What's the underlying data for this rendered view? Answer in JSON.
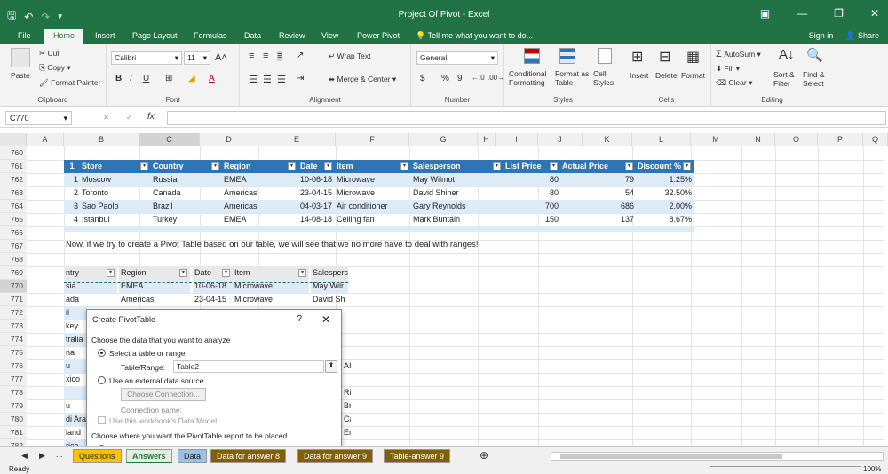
{
  "window": {
    "title": "Project Of Pivot - Excel"
  },
  "tabs": [
    "File",
    "Home",
    "Insert",
    "Page Layout",
    "Formulas",
    "Data",
    "Review",
    "View",
    "Power Pivot"
  ],
  "tell_me": "Tell me what you want to do...",
  "sign_in": "Sign in",
  "share": "Share",
  "ribbon": {
    "clipboard": {
      "paste": "Paste",
      "cut": "Cut",
      "copy": "Copy",
      "format_painter": "Format Painter",
      "label": "Clipboard"
    },
    "font": {
      "name": "Calibri",
      "size": "11",
      "bold": "B",
      "italic": "I",
      "underline": "U",
      "label": "Font"
    },
    "alignment": {
      "wrap": "Wrap Text",
      "merge": "Merge & Center",
      "label": "Alignment"
    },
    "number": {
      "format": "General",
      "currency": "$",
      "percent": "%",
      "comma": "9",
      "label": "Number"
    },
    "styles": {
      "cond": "Conditional Formatting",
      "table": "Format as Table",
      "cell": "Cell Styles",
      "label": "Styles"
    },
    "cells": {
      "insert": "Insert",
      "delete": "Delete",
      "format": "Format",
      "label": "Cells"
    },
    "editing": {
      "autosum": "AutoSum",
      "fill": "Fill",
      "clear": "Clear",
      "sort": "Sort & Filter",
      "find": "Find & Select",
      "label": "Editing"
    }
  },
  "formula_bar": {
    "name_box": "C770",
    "fx": "fx",
    "content": ""
  },
  "columns": [
    "A",
    "B",
    "C",
    "D",
    "E",
    "F",
    "G",
    "H",
    "I",
    "J",
    "K",
    "L",
    "M",
    "N",
    "O",
    "P",
    "Q"
  ],
  "rows": [
    "760",
    "761",
    "762",
    "763",
    "764",
    "765",
    "766",
    "767",
    "768",
    "769",
    "770",
    "771",
    "772",
    "773",
    "774",
    "775",
    "776",
    "777",
    "778",
    "779",
    "780",
    "781",
    "782"
  ],
  "table": {
    "headers": [
      "Store",
      "Country",
      "Region",
      "Date",
      "Item",
      "Salesperson",
      "List Price",
      "Actual Price",
      "Discount %"
    ],
    "rows": [
      {
        "n": "1",
        "cells": [
          "Moscow",
          "Russia",
          "EMEA",
          "10-06-18",
          "Microwave",
          "May Wilmot",
          "80",
          "79",
          "1.25%"
        ]
      },
      {
        "n": "2",
        "cells": [
          "Toronto",
          "Canada",
          "Americas",
          "23-04-15",
          "Microwave",
          "David Shiner",
          "80",
          "54",
          "32.50%"
        ]
      },
      {
        "n": "3",
        "cells": [
          "Sao Paolo",
          "Brazil",
          "Americas",
          "04-03-17",
          "Air conditioner",
          "Gary Reynolds",
          "700",
          "686",
          "2.00%"
        ]
      },
      {
        "n": "4",
        "cells": [
          "Istanbul",
          "Turkey",
          "EMEA",
          "14-08-18",
          "Ceiling fan",
          "Mark Buntain",
          "150",
          "137",
          "8.67%"
        ]
      }
    ],
    "header_index": "1"
  },
  "note": "Now, if we try to create a Pivot Table based on our table, we will see that we no more have to deal with ranges!",
  "lower": {
    "headers": [
      "ntry",
      "Region",
      "Date",
      "Item",
      "Salespers"
    ],
    "row1": [
      "sia",
      "EMEA",
      "10-06-18",
      "Microwave",
      "May Wilr"
    ],
    "row2": [
      "ada",
      "Americas",
      "23-04-15",
      "Microwave",
      "David Sh"
    ],
    "left_frags": [
      "il",
      "key",
      "tralia",
      "na",
      "u",
      "xico",
      "",
      "u",
      "di Ara",
      "land",
      "rico"
    ],
    "right_frags": [
      "",
      "",
      "",
      "",
      "",
      "",
      "",
      "AI",
      "",
      "Ri",
      "Br",
      "Ca",
      "Er"
    ]
  },
  "dialog": {
    "title": "Create PivotTable",
    "help": "?",
    "close": "✕",
    "section1": "Choose the data that you want to analyze",
    "opt1": "Select a table or range",
    "range_label": "Table/Range:",
    "range_value": "Table2",
    "opt2": "Use an external data source",
    "choose_conn": "Choose Connection...",
    "conn_name": "Connection name:",
    "data_model": "Use this workbook's Data Model",
    "section2": "Choose where you want the PivotTable report to be placed"
  },
  "sheet_tabs": [
    {
      "label": "Questions",
      "color": "#ffc000"
    },
    {
      "label": "Answers",
      "color": "#e2efda"
    },
    {
      "label": "Data",
      "color": "#9bc2e6"
    },
    {
      "label": "Data for answer 8",
      "color": "#806000"
    },
    {
      "label": "Data for answer 9",
      "color": "#806000"
    },
    {
      "label": "Table-answer 9",
      "color": "#806000"
    }
  ],
  "status": {
    "ready": "Ready",
    "zoom": "100%",
    "more": "..."
  }
}
